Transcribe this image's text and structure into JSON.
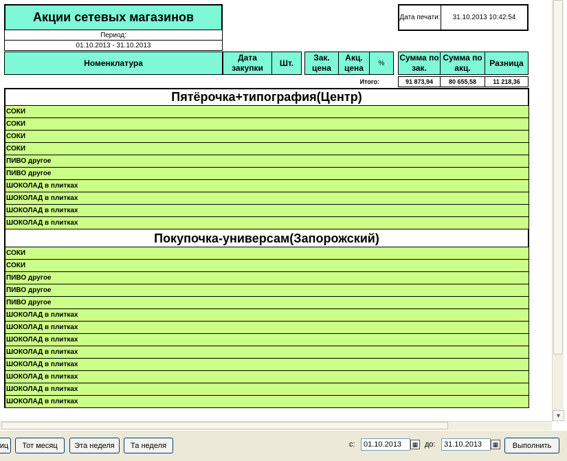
{
  "report": {
    "title": "Акции сетевых магазинов",
    "period_label": "Период:",
    "period_value": "01.10.2013 - 31.10.2013",
    "print_date_label": "Дата печати:",
    "print_date_value": "31.10.2013 10:42:54"
  },
  "columns": {
    "nomenclature": "Номенклатура",
    "purchase_date": "Дата закупки",
    "qty": "Шт.",
    "purchase_price": "Зак. цена",
    "promo_price": "Акц. цена",
    "percent": "%",
    "sum_purchase": "Сумма по зак.",
    "sum_promo": "Сумма по акц.",
    "difference": "Разница"
  },
  "totals": {
    "label": "Итого:",
    "sum_purchase": "91 873,94",
    "sum_promo": "80 655,58",
    "difference": "11 218,36"
  },
  "groups": [
    {
      "name": "Пятёрочка+типография(Центр)",
      "rows": [
        "СОКИ",
        "СОКИ",
        "СОКИ",
        "СОКИ",
        "ПИВО другое",
        "ПИВО другое",
        "ШОКОЛАД в плитках",
        "ШОКОЛАД в плитках",
        "ШОКОЛАД в плитках",
        "ШОКОЛАД в плитках"
      ]
    },
    {
      "name": "Покупочка-универсам(Запорожский)",
      "rows": [
        "СОКИ",
        "СОКИ",
        "ПИВО другое",
        "ПИВО другое",
        "ПИВО другое",
        "ШОКОЛАД в плитках",
        "ШОКОЛАД в плитках",
        "ШОКОЛАД в плитках",
        "ШОКОЛАД в плитках",
        "ШОКОЛАД в плитках",
        "ШОКОЛАД в плитках",
        "ШОКОЛАД в плитках",
        "ШОКОЛАД в плитках"
      ]
    }
  ],
  "toolbar": {
    "btn_partial": "иц",
    "btn_that_month": "Тот месяц",
    "btn_this_week": "Эта неделя",
    "btn_that_week": "Та неделя",
    "from_label": "с:",
    "from_value": "01.10.2013",
    "to_label": "до:",
    "to_value": "31.10.2013",
    "run_button": "Выполнить"
  },
  "colors": {
    "header_bg": "#7ff8d8",
    "row_bg": "#ccff88"
  },
  "icons": {
    "scroll_up": "▲",
    "scroll_down": "▼",
    "calendar": "▦"
  }
}
